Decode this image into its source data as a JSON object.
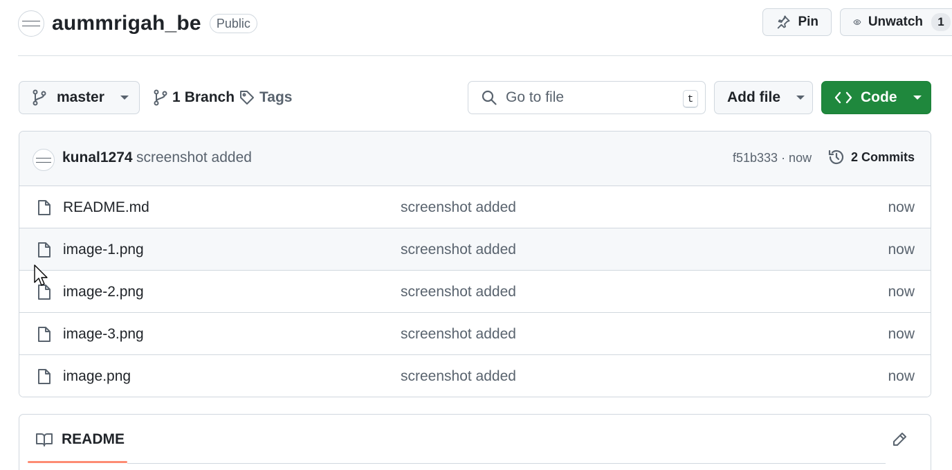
{
  "repo": {
    "name": "aummrigah_be",
    "visibility": "Public",
    "avatar_icon": "org-logo-icon"
  },
  "header_actions": {
    "pin_label": "Pin",
    "unwatch_label": "Unwatch",
    "watch_count": "1"
  },
  "toolbar": {
    "branch": "master",
    "branch_count": "1",
    "branch_word": "Branch",
    "tags_label": "Tags",
    "go_to_file_placeholder": "Go to file",
    "go_to_file_shortcut": "t",
    "add_file_label": "Add file",
    "code_label": "Code"
  },
  "latest_commit": {
    "author": "kunal1274",
    "message": "screenshot added",
    "meta": "f51b333 · now",
    "commits_label": "2 Commits"
  },
  "files": [
    {
      "name": "README.md",
      "commit": "screenshot added",
      "time": "now",
      "icon": "file-icon"
    },
    {
      "name": "image-1.png",
      "commit": "screenshot added",
      "time": "now",
      "icon": "file-icon"
    },
    {
      "name": "image-2.png",
      "commit": "screenshot added",
      "time": "now",
      "icon": "file-icon"
    },
    {
      "name": "image-3.png",
      "commit": "screenshot added",
      "time": "now",
      "icon": "file-icon"
    },
    {
      "name": "image.png",
      "commit": "screenshot added",
      "time": "now",
      "icon": "file-icon"
    }
  ],
  "readme": {
    "tab_label": "README"
  },
  "colors": {
    "code_button": "#1f883d",
    "readme_underline": "#fd8c73"
  }
}
